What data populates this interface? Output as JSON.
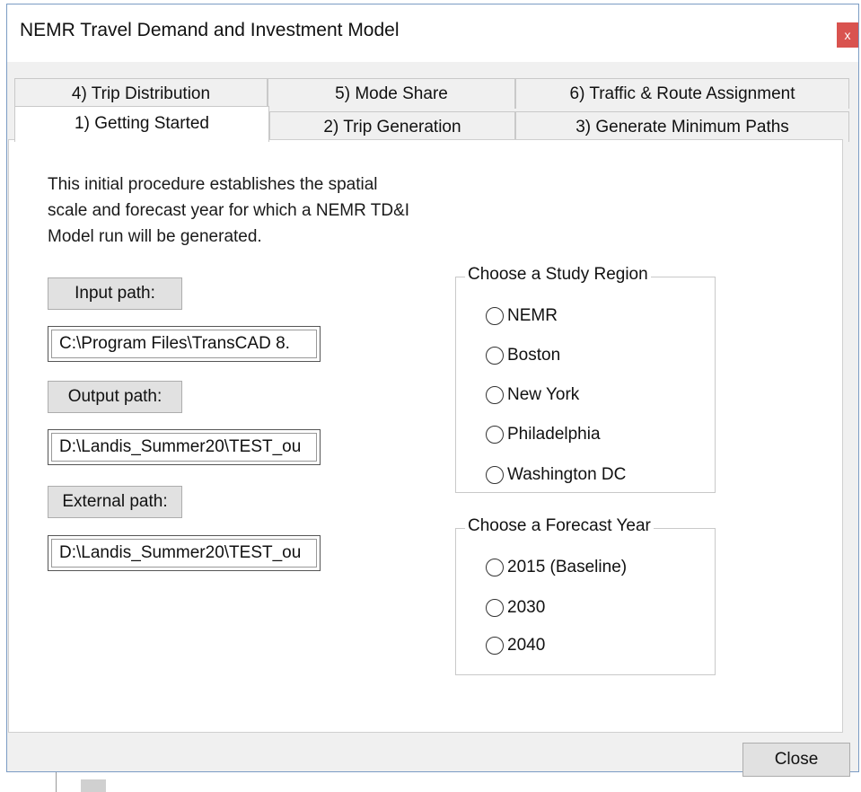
{
  "window": {
    "title": "NEMR Travel Demand and Investment Model",
    "close_glyph": "x"
  },
  "tabs": {
    "row_back": [
      {
        "label": "4) Trip Distribution"
      },
      {
        "label": "5) Mode Share"
      },
      {
        "label": "6) Traffic & Route Assignment"
      }
    ],
    "row_front": [
      {
        "label": "1) Getting Started",
        "active": true
      },
      {
        "label": "2) Trip Generation"
      },
      {
        "label": "3) Generate Minimum Paths"
      }
    ]
  },
  "getting_started": {
    "intro_lines": [
      "This initial procedure establishes the spatial",
      "scale and forecast year for which a NEMR TD&I",
      "Model run will be generated."
    ],
    "input_path_label": "Input path:",
    "input_path_value": "C:\\Program Files\\TransCAD 8.",
    "output_path_label": "Output path:",
    "output_path_value": "D:\\Landis_Summer20\\TEST_ou",
    "external_path_label": "External path:",
    "external_path_value": "D:\\Landis_Summer20\\TEST_ou"
  },
  "study_region": {
    "legend": "Choose a Study Region",
    "options": [
      "NEMR",
      "Boston",
      "New York",
      "Philadelphia",
      "Washington DC"
    ]
  },
  "forecast_year": {
    "legend": "Choose a Forecast Year",
    "options": [
      "2015 (Baseline)",
      "2030",
      "2040"
    ]
  },
  "footer": {
    "close_label": "Close"
  }
}
